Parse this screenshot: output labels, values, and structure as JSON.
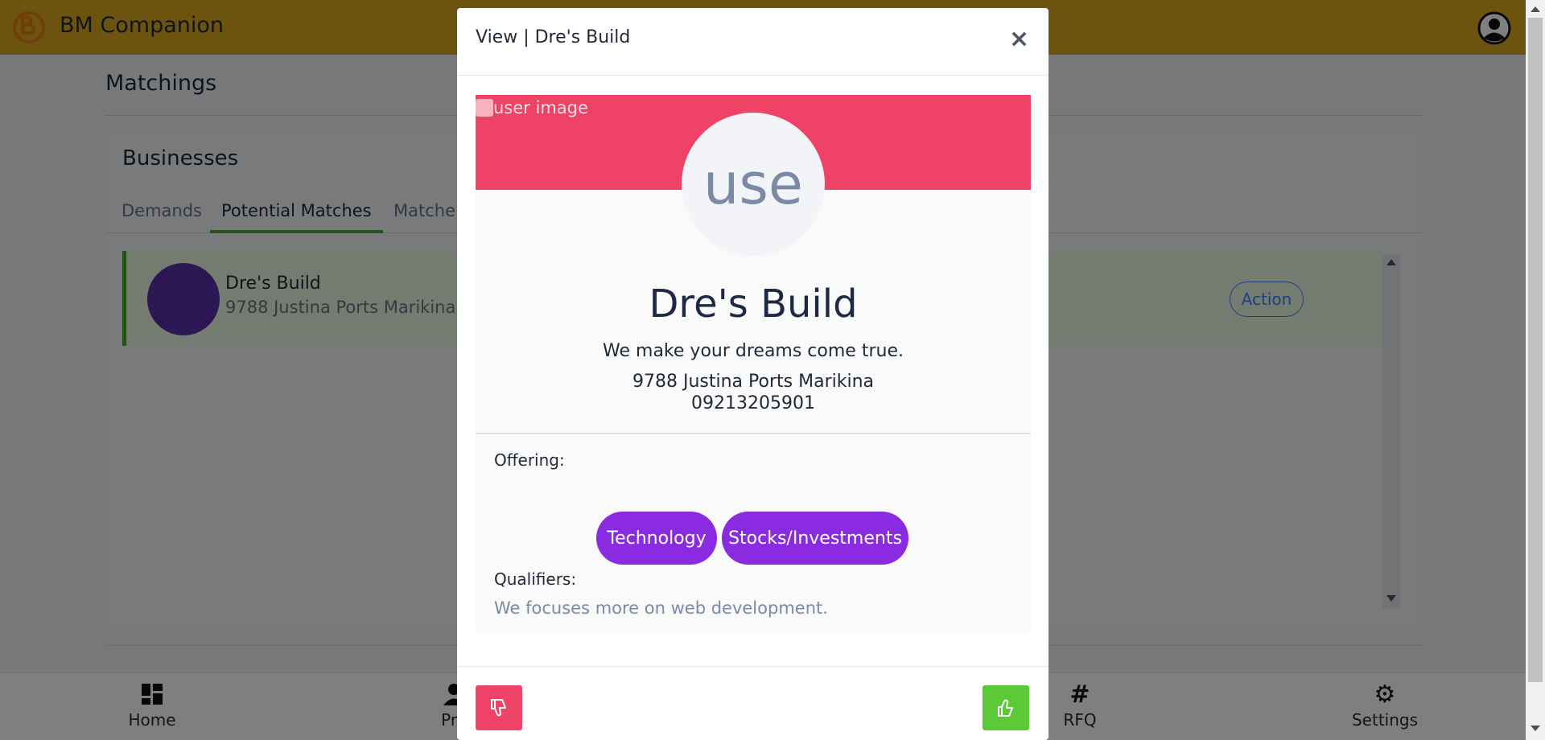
{
  "app": {
    "title": "BM Companion",
    "accent": "#d9a61c"
  },
  "page": {
    "title": "Matchings",
    "panel_title": "Businesses",
    "tabs": [
      "Demands",
      "Potential Matches",
      "Matche"
    ],
    "active_tab": "Potential Matches",
    "match": {
      "name": "Dre's Build",
      "address": "9788 Justina Ports Marikina",
      "action_label": "Action"
    }
  },
  "bottom_nav": [
    {
      "label": "Home",
      "icon": "dashboard-icon"
    },
    {
      "label": "Pro",
      "icon": "person-icon"
    },
    {
      "label": "RFQ",
      "icon": "hash-icon"
    },
    {
      "label": "Settings",
      "icon": "gear-icon"
    }
  ],
  "modal": {
    "title": "View | Dre's Build",
    "close_label": "×",
    "image_alt": "user image",
    "avatar_text": "use",
    "name": "Dre's Build",
    "tagline": "We make your dreams come true.",
    "address": "9788 Justina Ports Marikina",
    "phone": "09213205901",
    "offering_label": "Offering:",
    "tags": [
      "Technology",
      "Stocks/Investments"
    ],
    "qualifiers_label": "Qualifiers:",
    "qualifiers_text": "We focuses more on web development.",
    "colors": {
      "banner": "#ee4266",
      "tag": "#8a2be2",
      "like": "#5cc936",
      "dislike": "#ee4266"
    }
  }
}
